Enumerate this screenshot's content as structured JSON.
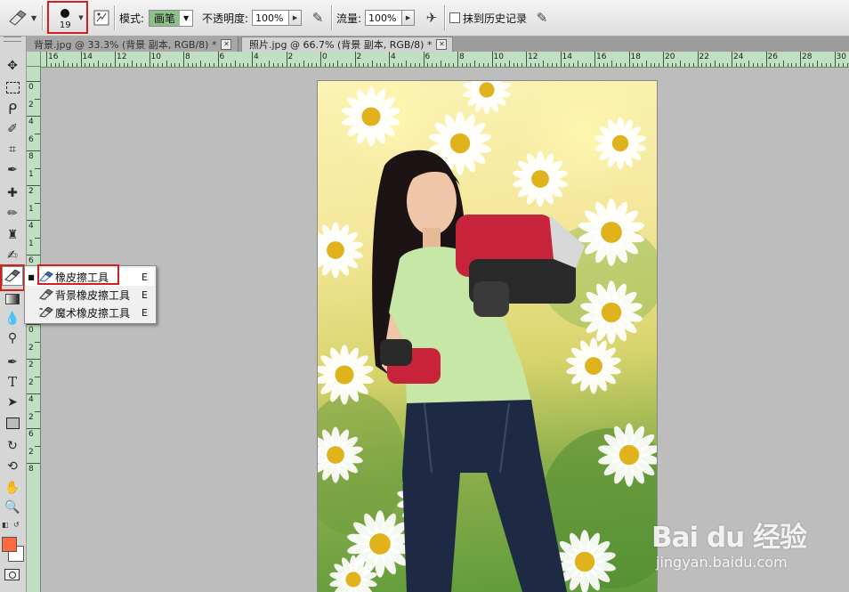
{
  "options_bar": {
    "brush_size": "19",
    "mode_label": "模式:",
    "mode_value": "画笔",
    "opacity_label": "不透明度:",
    "opacity_value": "100%",
    "flow_label": "流量:",
    "flow_value": "100%",
    "erase_history_label": "抹到历史记录",
    "erase_history_checked": false
  },
  "tabs": [
    {
      "label": "背景.jpg @ 33.3% (背景 副本, RGB/8) *",
      "active": false
    },
    {
      "label": "照片.jpg @ 66.7% (背景 副本, RGB/8) *",
      "active": true
    }
  ],
  "rulers": {
    "top_numbers": [
      "16",
      "14",
      "12",
      "10",
      "8",
      "6",
      "4",
      "2",
      "0",
      "2",
      "4",
      "6",
      "8",
      "10",
      "12",
      "14",
      "16",
      "18",
      "20",
      "22",
      "24",
      "26",
      "28",
      "30"
    ],
    "left_numbers": [
      "0",
      "2",
      "4",
      "6",
      "8",
      "1",
      "2",
      "1",
      "4",
      "1",
      "6",
      "1",
      "8",
      "2",
      "0",
      "2",
      "2",
      "2",
      "4",
      "2",
      "6",
      "2",
      "8"
    ]
  },
  "toolbox": {
    "tools": [
      "move-tool",
      "marquee-tool",
      "lasso-tool",
      "quick-selection-tool",
      "crop-tool",
      "eyedropper-tool",
      "healing-brush-tool",
      "brush-tool",
      "clone-stamp-tool",
      "history-brush-tool",
      "eraser-tool",
      "gradient-tool",
      "blur-tool",
      "dodge-tool",
      "pen-tool",
      "type-tool",
      "path-selection-tool",
      "shape-tool",
      "3d-rotate-tool",
      "3d-orbit-tool",
      "hand-tool",
      "zoom-tool"
    ],
    "foreground_color": "#ff6a3d",
    "background_color": "#ffffff"
  },
  "flyout_menu": {
    "items": [
      {
        "label": "橡皮擦工具",
        "key": "E",
        "selected": true,
        "icon": "eraser-icon"
      },
      {
        "label": "背景橡皮擦工具",
        "key": "E",
        "selected": false,
        "icon": "background-eraser-icon"
      },
      {
        "label": "魔术橡皮擦工具",
        "key": "E",
        "selected": false,
        "icon": "magic-eraser-icon"
      }
    ]
  },
  "watermark": {
    "logo": "Bai du 经验",
    "url": "jingyan.baidu.com"
  },
  "colors": {
    "highlight_red": "#d21f1f",
    "ruler_green": "#c1dfc3"
  }
}
